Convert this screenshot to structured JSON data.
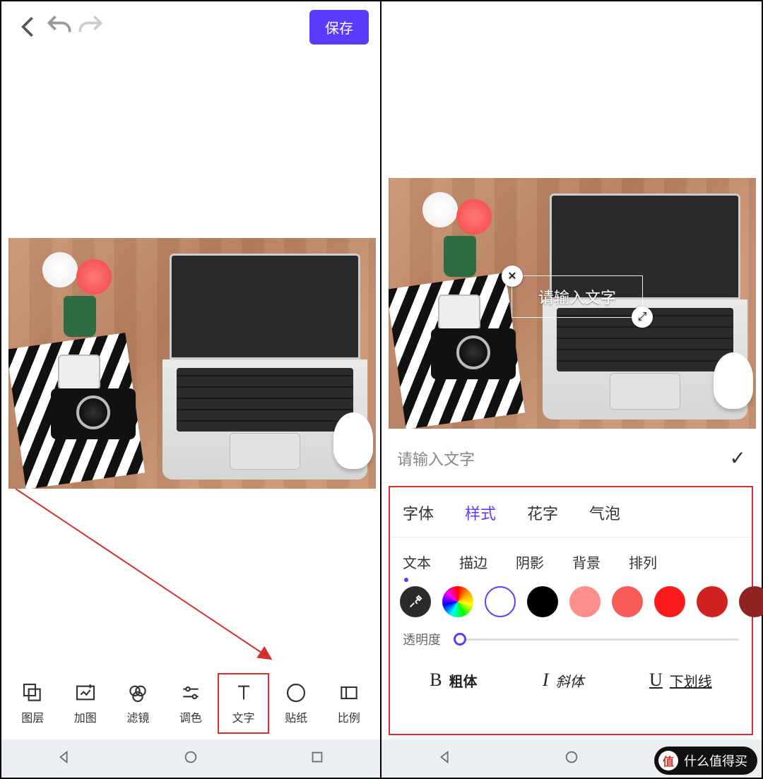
{
  "topbar": {
    "save_label": "保存"
  },
  "tools": {
    "layers": "图层",
    "add_image": "加图",
    "filter": "滤镜",
    "adjust": "调色",
    "text": "文字",
    "sticker": "贴纸",
    "ratio": "比例"
  },
  "text_editor": {
    "overlay_placeholder": "请输入文字",
    "input_placeholder": "请输入文字",
    "tabs": {
      "font": "字体",
      "style": "样式",
      "fancy": "花字",
      "bubble": "气泡"
    },
    "subtabs": {
      "text": "文本",
      "stroke": "描边",
      "shadow": "阴影",
      "background": "背景",
      "arrange": "排列"
    },
    "swatches": [
      "#000000",
      "#fd8e89",
      "#f85c59",
      "#fb1c1b",
      "#cf2221",
      "#8f2322"
    ],
    "opacity_label": "透明度",
    "style_buttons": {
      "bold": "粗体",
      "italic": "斜体",
      "underline": "下划线"
    }
  },
  "watermark": {
    "badge": "值",
    "text": "什么值得买"
  },
  "accent_color": "#5b3cff",
  "highlight_color": "#d3302e"
}
